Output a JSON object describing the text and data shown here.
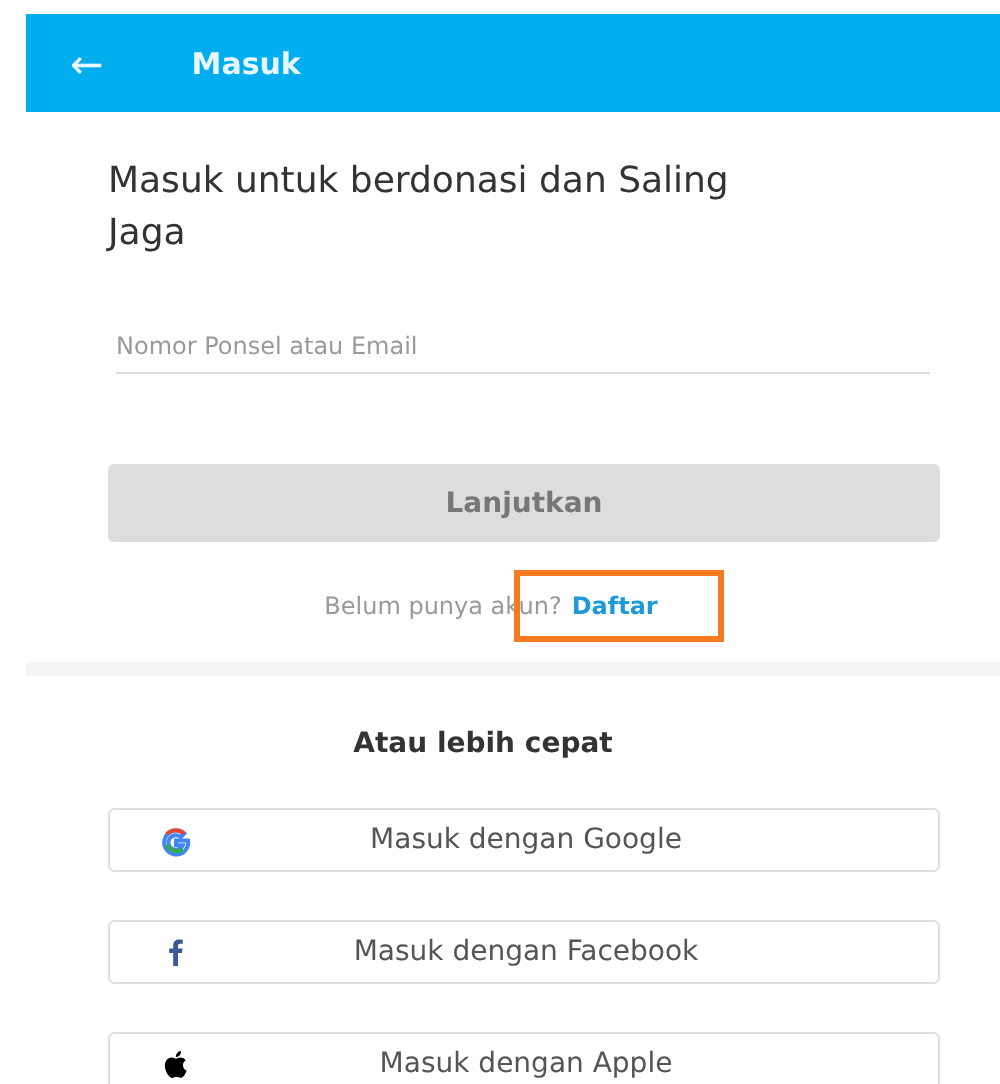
{
  "header": {
    "back_icon": "←",
    "title": "Masuk"
  },
  "heading": "Masuk untuk berdonasi dan Saling Jaga",
  "field": {
    "placeholder": "Nomor Ponsel atau Email"
  },
  "continue_button": {
    "label": "Lanjutkan",
    "disabled": true
  },
  "signup": {
    "prompt": "Belum punya akun?",
    "link": "Daftar",
    "highlighted": true
  },
  "alt_heading": "Atau lebih cepat",
  "social_buttons": [
    {
      "kind": "google",
      "label": "Masuk dengan Google"
    },
    {
      "kind": "facebook",
      "label": "Masuk dengan Facebook"
    },
    {
      "kind": "apple",
      "label": "Masuk dengan Apple"
    }
  ]
}
